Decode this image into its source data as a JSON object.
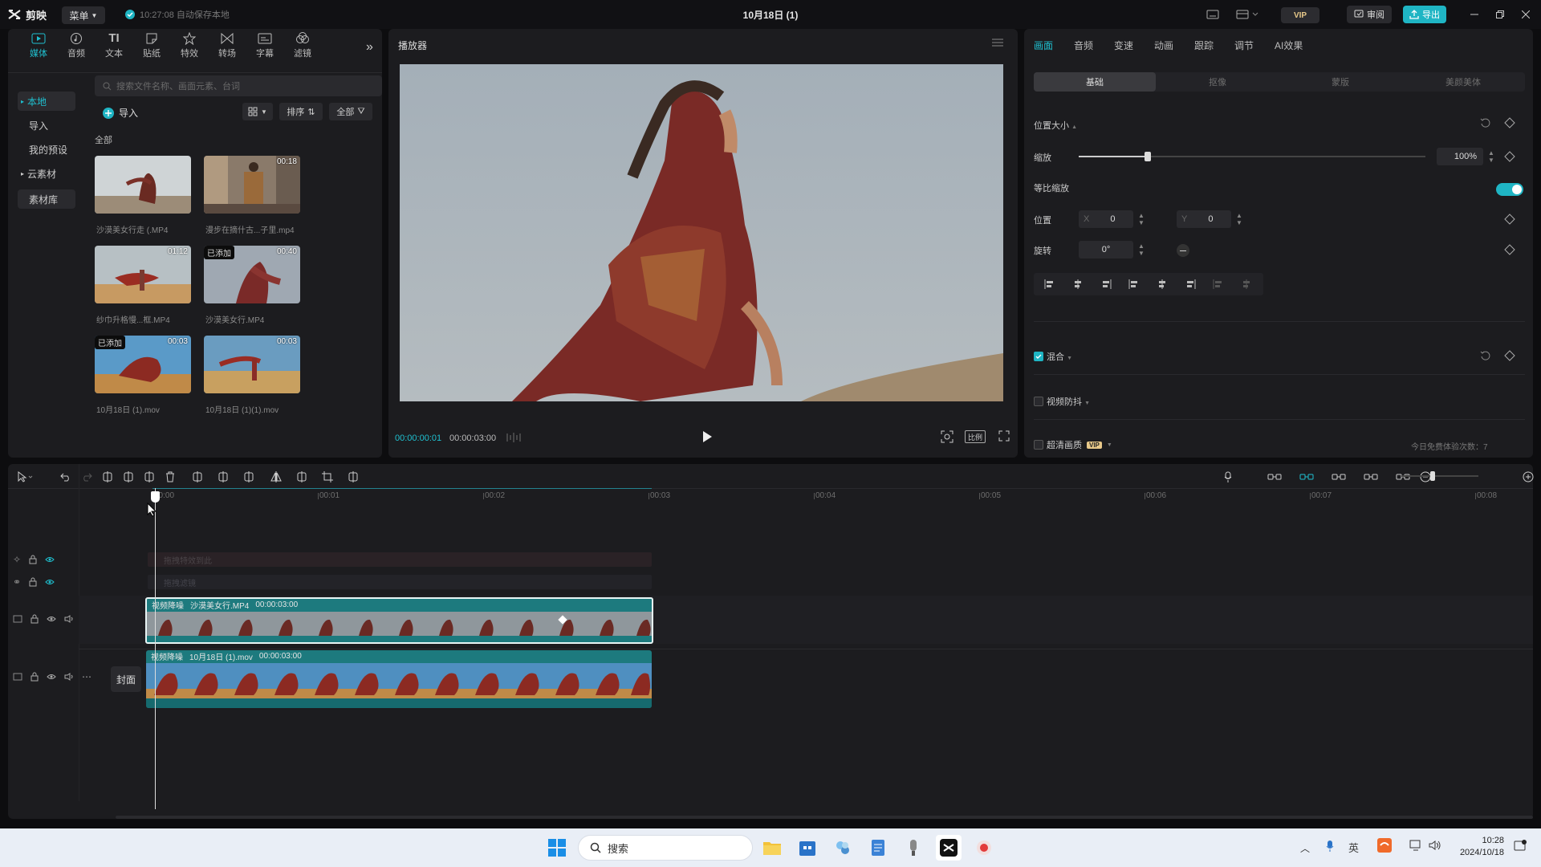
{
  "app": {
    "name": "剪映",
    "menu_label": "菜单",
    "autosave": "10:27:08 自动保存本地",
    "project_title": "10月18日 (1)",
    "vip_label": "VIP",
    "review_label": "审阅",
    "export_label": "导出"
  },
  "media_tabs": [
    {
      "label": "媒体",
      "icon": "media-icon",
      "active": true
    },
    {
      "label": "音频",
      "icon": "audio-icon"
    },
    {
      "label": "文本",
      "icon": "text-icon"
    },
    {
      "label": "贴纸",
      "icon": "sticker-icon"
    },
    {
      "label": "特效",
      "icon": "effects-icon"
    },
    {
      "label": "转场",
      "icon": "transition-icon"
    },
    {
      "label": "字幕",
      "icon": "subtitle-icon"
    },
    {
      "label": "滤镜",
      "icon": "filter-icon"
    }
  ],
  "sidebar": {
    "items": [
      {
        "label": "本地",
        "active": true
      },
      {
        "label": "导入"
      },
      {
        "label": "我的预设"
      },
      {
        "label": "云素材"
      },
      {
        "label": "素材库"
      }
    ]
  },
  "media": {
    "search_placeholder": "搜索文件名称、画面元素、台词",
    "import_label": "导入",
    "sort_label": "排序",
    "filter_label": "全部",
    "section_label": "全部",
    "clips": [
      {
        "name": "沙漠美女行走 (.MP4",
        "duration": "",
        "added": ""
      },
      {
        "name": "漫步在摘什古...子里.mp4",
        "duration": "00:18",
        "added": ""
      },
      {
        "name": "纱巾升格慢...框.MP4",
        "duration": "01:12",
        "added": ""
      },
      {
        "name": "沙漠美女行.MP4",
        "duration": "00:40",
        "added": "已添加"
      },
      {
        "name": "10月18日 (1).mov",
        "duration": "00:03",
        "added": "已添加"
      },
      {
        "name": "10月18日 (1)(1).mov",
        "duration": "00:03",
        "added": ""
      }
    ]
  },
  "player": {
    "title": "播放器",
    "current_time": "00:00:00:01",
    "total_time": "00:00:03:00",
    "ratio_label": "比例"
  },
  "props": {
    "tabs": [
      "画面",
      "音频",
      "变速",
      "动画",
      "跟踪",
      "调节",
      "AI效果"
    ],
    "subtabs": [
      "基础",
      "抠像",
      "蒙版",
      "美颜美体"
    ],
    "section_position": "位置大小",
    "scale_label": "缩放",
    "scale_value": "100%",
    "scale_fraction": 0.2,
    "uniform_label": "等比缩放",
    "position_label": "位置",
    "x_label": "X",
    "x_value": "0",
    "y_label": "Y",
    "y_value": "0",
    "rotate_label": "旋转",
    "rotate_value": "0°",
    "blend_label": "混合",
    "stabilize_label": "视频防抖",
    "hd_label": "超清画质",
    "hd_badge": "VIP",
    "free_trials": "今日免费体验次数：7"
  },
  "timeline": {
    "ruler": [
      "00:00",
      "00:01",
      "00:02",
      "00:03",
      "00:04",
      "00:05",
      "00:06",
      "00:07",
      "00:08"
    ],
    "effects_track_placeholder": "拖拽特效到此",
    "filter_track_placeholder": "拖拽滤镜",
    "clip1": {
      "tag": "视频降噪",
      "name": "沙漠美女行.MP4",
      "duration": "00:00:03:00"
    },
    "clip2": {
      "tag": "视频降噪",
      "name": "10月18日 (1).mov",
      "duration": "00:00:03:00"
    },
    "cover_label": "封面"
  },
  "taskbar": {
    "search_label": "搜索",
    "time": "10:28",
    "date": "2024/10/18"
  },
  "colors": {
    "accent": "#1fc0d0",
    "export_bg": "#1fb5c4",
    "clip_teal": "#1d7a7e",
    "panel_bg": "#1c1c1f"
  }
}
